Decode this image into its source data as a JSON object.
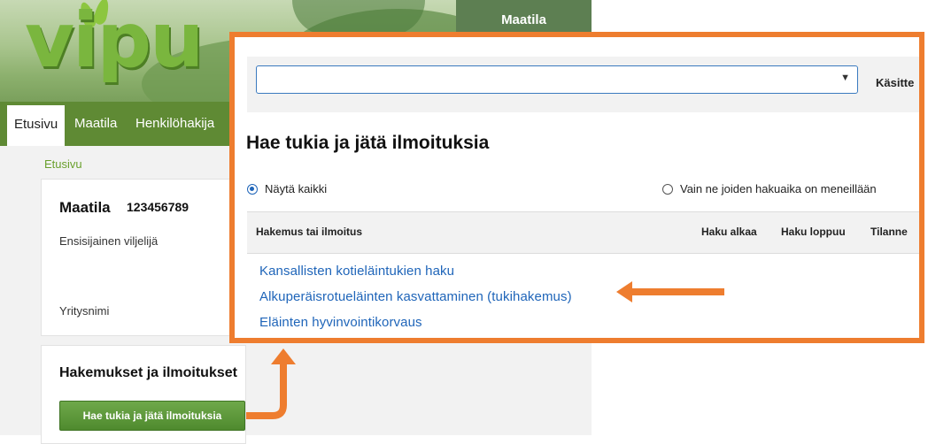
{
  "brand": {
    "logo_text": "vipu",
    "accent": "#5f8a34",
    "orange": "#ee7d2f",
    "link_blue": "#1f65b9"
  },
  "header": {
    "maatila_label": "Maatila"
  },
  "nav": {
    "items": [
      "Etusivu",
      "Maatila",
      "Henkilöhakija"
    ]
  },
  "breadcrumb": "Etusivu",
  "farm_card": {
    "title": "Maatila",
    "id": "123456789",
    "primary_farmer_label": "Ensisijainen viljelijä",
    "company_label": "Yritysnimi"
  },
  "applications_card": {
    "title": "Hakemukset ja ilmoitukset",
    "button_label": "Hae tukia ja jätä ilmoituksia"
  },
  "popup": {
    "select_value": "",
    "kasitte_label": "Käsitte",
    "heading": "Hae tukia ja jätä ilmoituksia",
    "radio_all": "Näytä kaikki",
    "radio_open": "Vain ne joiden hakuaika on meneillään",
    "radio_selected": "all",
    "columns": [
      "Hakemus tai ilmoitus",
      "Haku alkaa",
      "Haku loppuu",
      "Tilanne"
    ],
    "links": [
      "Kansallisten kotieläintukien haku",
      "Alkuperäisrotueläinten kasvattaminen (tukihakemus)",
      "Eläinten hyvinvointikorvaus"
    ]
  },
  "icons": {
    "select_caret": "caret-down-icon",
    "annotation_arrow": "arrow-left-icon"
  }
}
